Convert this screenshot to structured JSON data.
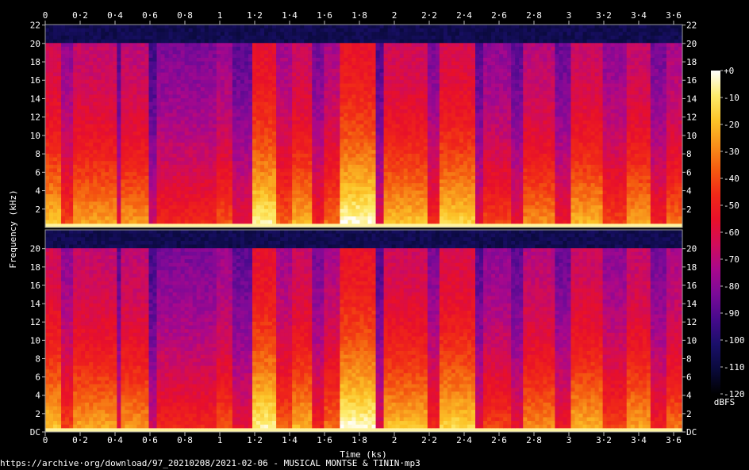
{
  "chart_data": {
    "type": "heatmap",
    "xlabel": "Time (ks)",
    "ylabel": "Frequency (kHz)",
    "x_ticks": [
      "0",
      "0·2",
      "0·4",
      "0·6",
      "0·8",
      "1",
      "1·2",
      "1·4",
      "1·6",
      "1·8",
      "2",
      "2·2",
      "2·4",
      "2·6",
      "2·8",
      "3",
      "3·2",
      "3·4",
      "3·6"
    ],
    "x_tick_values": [
      0,
      0.2,
      0.4,
      0.6,
      0.8,
      1.0,
      1.2,
      1.4,
      1.6,
      1.8,
      2.0,
      2.2,
      2.4,
      2.6,
      2.8,
      3.0,
      3.2,
      3.4,
      3.6
    ],
    "xlim": [
      0,
      3.65
    ],
    "channels": [
      {
        "name": "upper",
        "y_ticks": [
          "2",
          "4",
          "6",
          "8",
          "10",
          "12",
          "14",
          "16",
          "18",
          "20",
          "22"
        ],
        "y_tick_values": [
          2,
          4,
          6,
          8,
          10,
          12,
          14,
          16,
          18,
          20,
          22
        ]
      },
      {
        "name": "lower",
        "y_ticks": [
          "DC",
          "2",
          "4",
          "6",
          "8",
          "10",
          "12",
          "14",
          "16",
          "18",
          "20"
        ],
        "y_tick_values": [
          0,
          2,
          4,
          6,
          8,
          10,
          12,
          14,
          16,
          18,
          20
        ]
      }
    ],
    "ylim": [
      0,
      22.05
    ],
    "colorbar": {
      "label": "dBFS",
      "ticks": [
        "+0",
        "-10",
        "-20",
        "-30",
        "-40",
        "-50",
        "-60",
        "-70",
        "-80",
        "-90",
        "-100",
        "-110",
        "-120"
      ],
      "tick_values": [
        0,
        -10,
        -20,
        -30,
        -40,
        -50,
        -60,
        -70,
        -80,
        -90,
        -100,
        -110,
        -120
      ],
      "range": [
        -120,
        0
      ],
      "stops": [
        "#000000",
        "#0a0a3c",
        "#1a0f6a",
        "#460a8c",
        "#7a0a98",
        "#a8088c",
        "#d00c5a",
        "#e8102a",
        "#f02818",
        "#f45a10",
        "#f8901a",
        "#fcc428",
        "#fdec6c",
        "#ffffff"
      ]
    },
    "spectrum": {
      "cutoff_khz": 20.1,
      "segments": [
        {
          "t0": 0.0,
          "t1": 0.1,
          "level": 0.75
        },
        {
          "t0": 0.1,
          "t1": 0.16,
          "level": 0.55
        },
        {
          "t0": 0.16,
          "t1": 0.4,
          "level": 0.7
        },
        {
          "t0": 0.4,
          "t1": 0.44,
          "level": 0.4
        },
        {
          "t0": 0.44,
          "t1": 0.6,
          "level": 0.68
        },
        {
          "t0": 0.6,
          "t1": 0.64,
          "level": 0.35
        },
        {
          "t0": 0.64,
          "t1": 0.98,
          "level": 0.5
        },
        {
          "t0": 0.98,
          "t1": 1.08,
          "level": 0.58
        },
        {
          "t0": 1.08,
          "t1": 1.18,
          "level": 0.42
        },
        {
          "t0": 1.18,
          "t1": 1.32,
          "level": 0.85
        },
        {
          "t0": 1.32,
          "t1": 1.42,
          "level": 0.6
        },
        {
          "t0": 1.42,
          "t1": 1.52,
          "level": 0.72
        },
        {
          "t0": 1.52,
          "t1": 1.6,
          "level": 0.48
        },
        {
          "t0": 1.6,
          "t1": 1.68,
          "level": 0.62
        },
        {
          "t0": 1.68,
          "t1": 1.9,
          "level": 0.88
        },
        {
          "t0": 1.9,
          "t1": 1.94,
          "level": 0.38
        },
        {
          "t0": 1.94,
          "t1": 2.2,
          "level": 0.74
        },
        {
          "t0": 2.2,
          "t1": 2.26,
          "level": 0.5
        },
        {
          "t0": 2.26,
          "t1": 2.46,
          "level": 0.78
        },
        {
          "t0": 2.46,
          "t1": 2.52,
          "level": 0.4
        },
        {
          "t0": 2.52,
          "t1": 2.66,
          "level": 0.55
        },
        {
          "t0": 2.66,
          "t1": 2.74,
          "level": 0.42
        },
        {
          "t0": 2.74,
          "t1": 2.92,
          "level": 0.66
        },
        {
          "t0": 2.92,
          "t1": 3.02,
          "level": 0.45
        },
        {
          "t0": 3.02,
          "t1": 3.2,
          "level": 0.72
        },
        {
          "t0": 3.2,
          "t1": 3.34,
          "level": 0.55
        },
        {
          "t0": 3.34,
          "t1": 3.46,
          "level": 0.7
        },
        {
          "t0": 3.46,
          "t1": 3.56,
          "level": 0.48
        },
        {
          "t0": 3.56,
          "t1": 3.65,
          "level": 0.62
        }
      ]
    }
  },
  "footer": {
    "source": "https://archive·org/download/97_20210208/2021-02-06 - MUSICAL MONTSE & TININ·mp3"
  }
}
